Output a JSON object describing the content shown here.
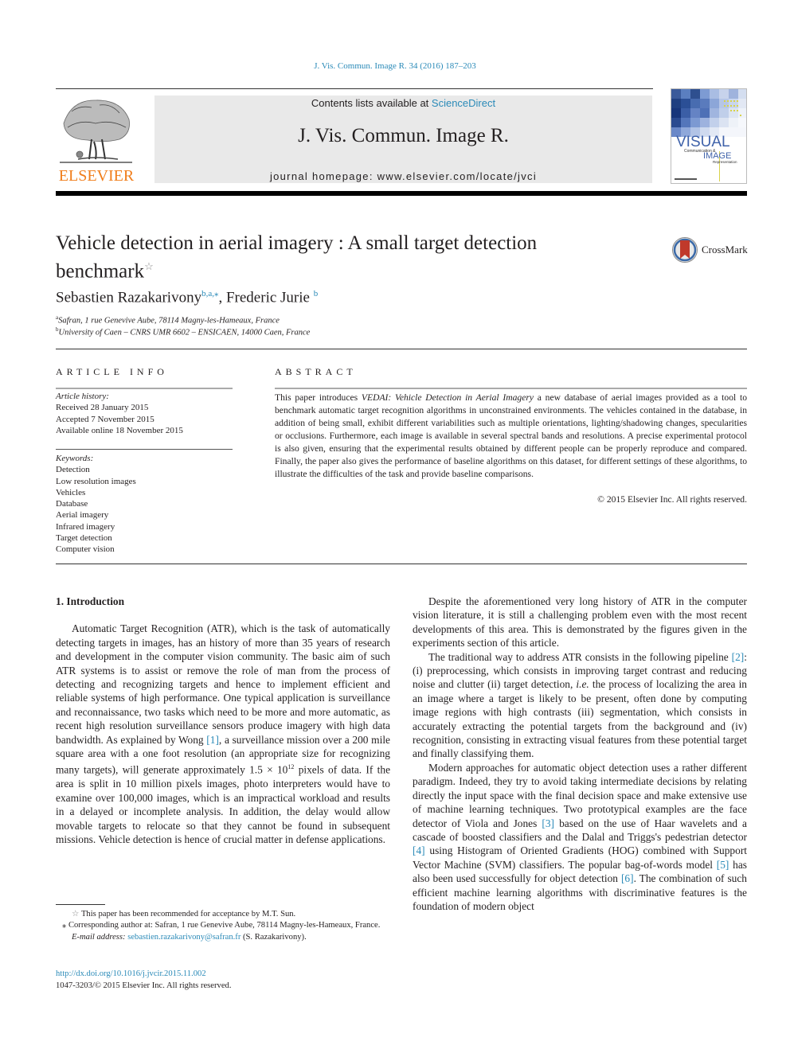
{
  "header": {
    "citation": "J. Vis. Commun. Image R. 34 (2016) 187–203",
    "publisher_logo_text": "ELSEVIER",
    "contents_prefix": "Contents lists available at ",
    "contents_link": "ScienceDirect",
    "journal_title": "J. Vis. Commun. Image R.",
    "homepage": "journal homepage: www.elsevier.com/locate/jvci",
    "cover": {
      "line1": "VISUAL",
      "line2": "Communication &",
      "line3": "IMAGE",
      "line4": "Representation"
    }
  },
  "article": {
    "title_line1": "Vehicle detection in aerial imagery : A small target detection",
    "title_line2": "benchmark",
    "title_mark": "☆",
    "crossmark_label": "CrossMark",
    "authors": [
      {
        "name": "Sebastien Razakarivony",
        "sup": "b,a,",
        "star": "⁎"
      },
      {
        "name": "Frederic Jurie",
        "sup": "b"
      }
    ],
    "author_separator": ", ",
    "affiliations": [
      {
        "key": "a",
        "text": "Safran, 1 rue Genevive Aube, 78114 Magny-les-Hameaux, France"
      },
      {
        "key": "b",
        "text": "University of Caen – CNRS UMR 6602 – ENSICAEN, 14000 Caen, France"
      }
    ]
  },
  "article_info": {
    "heading": "ARTICLE INFO",
    "history_label": "Article history:",
    "history": [
      "Received 28 January 2015",
      "Accepted 7 November 2015",
      "Available online 18 November 2015"
    ],
    "keywords_label": "Keywords:",
    "keywords": [
      "Detection",
      "Low resolution images",
      "Vehicles",
      "Database",
      "Aerial imagery",
      "Infrared imagery",
      "Target detection",
      "Computer vision"
    ]
  },
  "abstract": {
    "heading": "ABSTRACT",
    "pre": "This paper introduces ",
    "italic": "VEDAI: Vehicle Detection in Aerial Imagery",
    "post": " a new database of aerial images provided as a tool to benchmark automatic target recognition algorithms in unconstrained environments. The vehicles contained in the database, in addition of being small, exhibit different variabilities such as multiple orientations, lighting/shadowing changes, specularities or occlusions. Furthermore, each image is available in several spectral bands and resolutions. A precise experimental protocol is also given, ensuring that the experimental results obtained by different people can be properly reproduce and compared. Finally, the paper also gives the performance of baseline algorithms on this dataset, for different settings of these algorithms, to illustrate the difficulties of the task and provide baseline comparisons.",
    "copyright": "© 2015 Elsevier Inc. All rights reserved."
  },
  "body": {
    "section_heading": "1. Introduction",
    "left_p1_a": "Automatic Target Recognition (ATR), which is the task of automatically detecting targets in images, has an history of more than 35 years of research and development in the computer vision community. The basic aim of such ATR systems is to assist or remove the role of man from the process of detecting and recognizing targets and hence to implement efficient and reliable systems of high performance. One typical application is surveillance and reconnaissance, two tasks which need to be more and more automatic, as recent high resolution surveillance sensors produce imagery with high data bandwidth. As explained by Wong ",
    "ref1": "[1]",
    "left_p1_b": ", a surveillance mission over a 200 mile square area with a one foot resolution (an appropriate size for recognizing many targets), will generate approximately 1.5 × 10",
    "exp": "12",
    "left_p1_c": " pixels of data. If the area is split in 10 million pixels images, photo interpreters would have to examine over 100,000 images, which is an impractical workload and results in a delayed or incomplete analysis. In addition, the delay would allow movable targets to relocate so that they cannot be found in subsequent missions. Vehicle detection is hence of crucial matter in defense applications.",
    "right_p1": "Despite the aforementioned very long history of ATR in the computer vision literature, it is still a challenging problem even with the most recent developments of this area. This is demonstrated by the figures given in the experiments section of this article.",
    "right_p2_a": "The traditional way to address ATR consists in the following pipeline ",
    "ref2": "[2]",
    "right_p2_b": ": (i) preprocessing, which consists in improving target contrast and reducing noise and clutter (ii) target detection, ",
    "ie": "i.e.",
    "right_p2_c": " the process of localizing the area in an image where a target is likely to be present, often done by computing image regions with high contrasts (iii) segmentation, which consists in accurately extracting the potential targets from the background and (iv) recognition, consisting in extracting visual features from these potential target and finally classifying them.",
    "right_p3_a": "Modern approaches for automatic object detection uses a rather different paradigm. Indeed, they try to avoid taking intermediate decisions by relating directly the input space with the final decision space and make extensive use of machine learning techniques. Two prototypical examples are the face detector of Viola and Jones ",
    "ref3": "[3]",
    "right_p3_b": " based on the use of Haar wavelets and a cascade of boosted classifiers and the Dalal and Triggs's pedestrian detector ",
    "ref4": "[4]",
    "right_p3_c": " using Histogram of Oriented Gradients (HOG) combined with Support Vector Machine (SVM) classifiers. The popular bag-of-words model ",
    "ref5": "[5]",
    "right_p3_d": " has also been used successfully for object detection ",
    "ref6": "[6]",
    "right_p3_e": ". The combination of such efficient machine learning algorithms with discriminative features is the foundation of modern object"
  },
  "footnotes": {
    "fn1_mark": "☆",
    "fn1": " This paper has been recommended for acceptance by M.T. Sun.",
    "fn2_mark": "⁎",
    "fn2": " Corresponding author at: Safran, 1 rue Genevive Aube, 78114 Magny-les-Hameaux, France.",
    "email_label": "E-mail address: ",
    "email": "sebastien.razakarivony@safran.fr",
    "email_suffix": " (S. Razakarivony).",
    "doi": "http://dx.doi.org/10.1016/j.jvcir.2015.11.002",
    "issn": "1047-3203/© 2015 Elsevier Inc. All rights reserved."
  },
  "colors": {
    "link": "#2a8ab8",
    "elsevier_orange": "#f07d1a",
    "masthead_bg": "#e9e9e9"
  }
}
